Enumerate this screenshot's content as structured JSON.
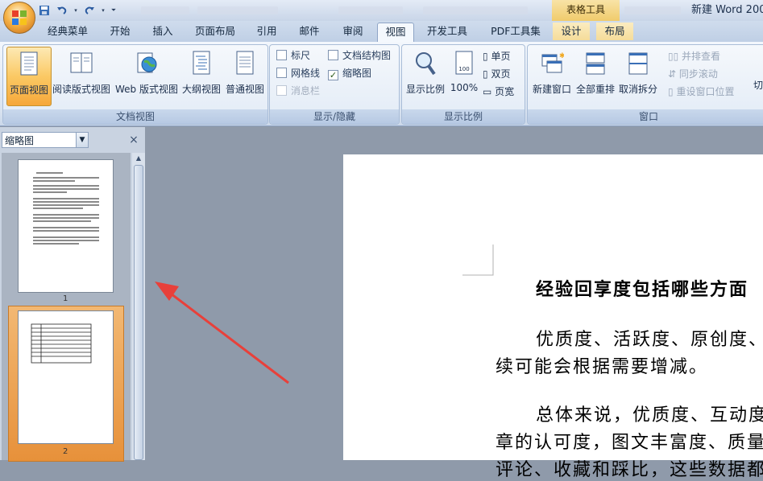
{
  "titlebar": {
    "context_tools_label": "表格工具",
    "document_title": "新建 Word 200"
  },
  "tabs": [
    "经典菜单",
    "开始",
    "插入",
    "页面布局",
    "引用",
    "邮件",
    "审阅",
    "视图",
    "开发工具",
    "PDF工具集",
    "设计",
    "布局"
  ],
  "active_tab": "视图",
  "ribbon": {
    "doc_views": {
      "label": "文档视图",
      "buttons": [
        "页面视图",
        "阅读版式视图",
        "Web 版式视图",
        "大纲视图",
        "普通视图"
      ]
    },
    "show_hide": {
      "label": "显示/隐藏",
      "ruler": "标尺",
      "gridlines": "网格线",
      "message_bar": "消息栏",
      "doc_map": "文档结构图",
      "thumbnails": "缩略图",
      "thumbnails_checked": true
    },
    "zoom": {
      "label": "显示比例",
      "zoom_button": "显示比例",
      "hundred": "100%",
      "hundred_icon_text": "100",
      "one_page": "单页",
      "two_pages": "双页",
      "page_width": "页宽"
    },
    "window": {
      "label": "窗口",
      "new_window": "新建窗口",
      "arrange_all": "全部重排",
      "split": "取消拆分",
      "side_by_side": "并排查看",
      "sync_scroll": "同步滚动",
      "reset_position": "重设窗口位置",
      "switch": "切"
    }
  },
  "pane": {
    "dropdown_value": "缩略图",
    "close_glyph": "×",
    "pages": [
      "1",
      "2"
    ]
  },
  "document": {
    "heading": "经验回享度包括哪些方面",
    "para1_line1": "优质度、活跃度、原创度、",
    "para1_line2": "续可能会根据需要增减。",
    "para2_line1": "总体来说，优质度、互动度",
    "para2_line2": "章的认可度，图文丰富度、质量",
    "para2_line3": "评论、收藏和踩比，这些数据都"
  },
  "colors": {
    "annotation_arrow": "#e8403a",
    "active_button": "#f6a73a",
    "ribbon_bg": "#dae4f1"
  }
}
